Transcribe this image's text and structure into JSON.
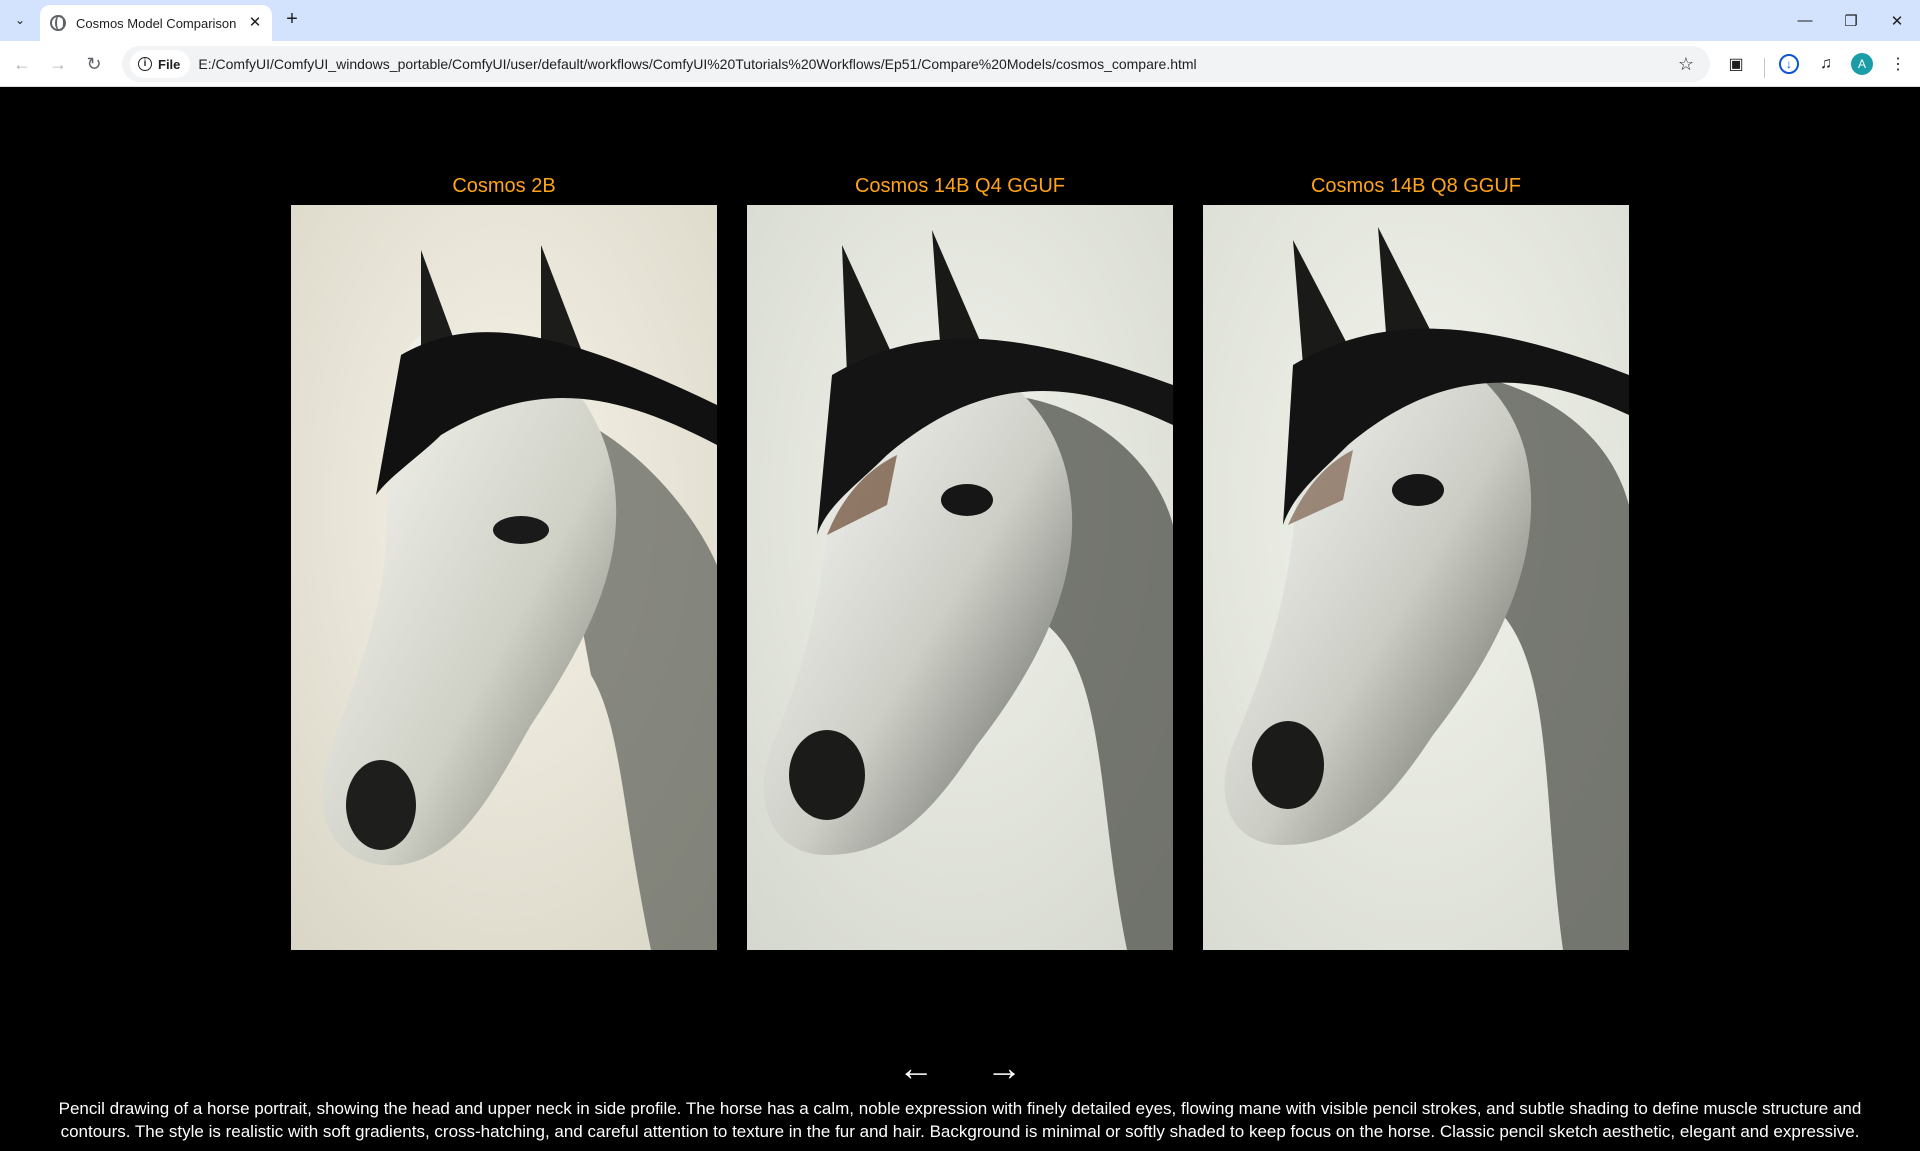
{
  "browser": {
    "tab_title": "Cosmos Model Comparison",
    "address_chip": "File",
    "url": "E:/ComfyUI/ComfyUI_windows_portable/ComfyUI/user/default/workflows/ComfyUI%20Tutorials%20Workflows/Ep51/Compare%20Models/cosmos_compare.html",
    "avatar_letter": "A"
  },
  "icons": {
    "tab_search": "chevron-down-icon",
    "favicon": "globe-icon",
    "tab_close": "close-icon",
    "new_tab": "plus-icon",
    "back": "arrow-left-icon",
    "forward": "arrow-right-icon",
    "reload": "reload-icon",
    "info": "info-icon",
    "bookmark": "star-icon",
    "extensions": "puzzle-icon",
    "downloads": "download-icon",
    "media": "media-controls-icon",
    "menu": "kebab-menu-icon"
  },
  "colors": {
    "panel_title": "#ffa31a",
    "page_background": "#000000",
    "tabstrip": "#d3e3fd"
  },
  "models": [
    {
      "name": "Cosmos 2B",
      "image": "horse-portrait-pencil-drawing"
    },
    {
      "name": "Cosmos 14B Q4 GGUF",
      "image": "horse-portrait-pencil-drawing"
    },
    {
      "name": "Cosmos 14B Q8 GGUF",
      "image": "horse-portrait-pencil-drawing"
    }
  ],
  "nav": {
    "prev": "←",
    "next": "→"
  },
  "prompt": "Pencil drawing of a horse portrait, showing the head and upper neck in side profile. The horse has a calm, noble expression with finely detailed eyes, flowing mane with visible pencil strokes, and subtle shading to define muscle structure and contours. The style is realistic with soft gradients, cross-hatching, and careful attention to texture in the fur and hair. Background is minimal or softly shaded to keep focus on the horse. Classic pencil sketch aesthetic, elegant and expressive."
}
